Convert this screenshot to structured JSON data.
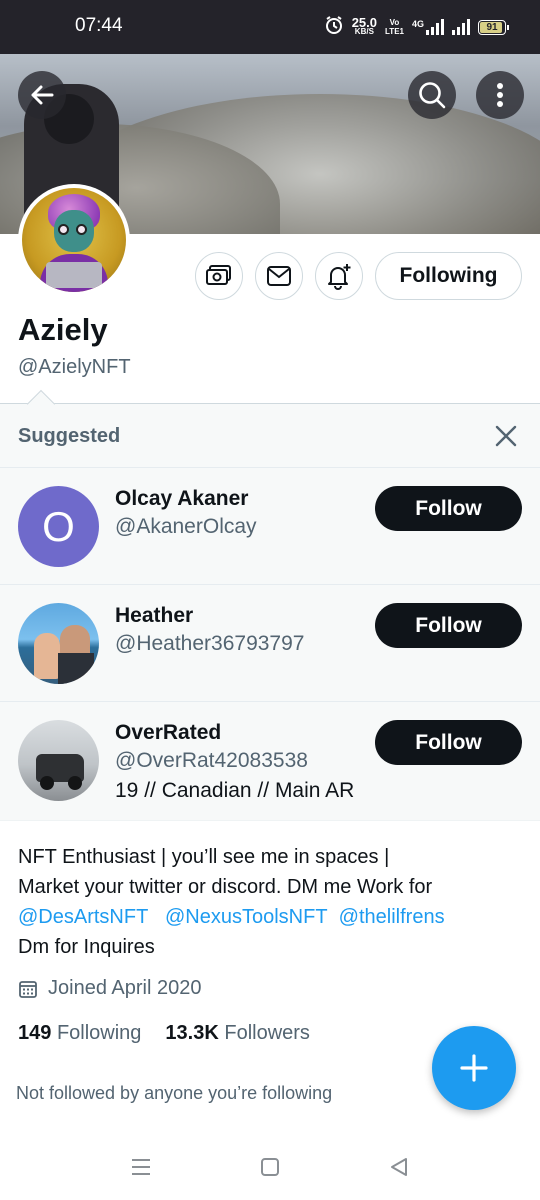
{
  "status_bar": {
    "time": "07:44",
    "net_speed_value": "25.0",
    "net_speed_unit": "KB/S",
    "volte_top": "Vo",
    "volte_bottom": "LTE1",
    "network_type": "4G",
    "battery": "91"
  },
  "header": {
    "back_icon": "arrow-left-icon",
    "search_icon": "search-icon",
    "more_icon": "more-vertical-icon"
  },
  "profile": {
    "display_name": "Aziely",
    "handle": "@AzielyNFT",
    "following_button_label": "Following",
    "action_icons": [
      "tip-jar-icon",
      "message-icon",
      "notification-bell-icon"
    ]
  },
  "suggested": {
    "title": "Suggested",
    "close_icon": "close-icon",
    "items": [
      {
        "name": "Olcay Akaner",
        "handle": "@AkanerOlcay",
        "avatar_letter": "O",
        "avatar_color": "#6f6acb",
        "bio": "",
        "follow_label": "Follow"
      },
      {
        "name": "Heather",
        "handle": "@Heather36793797",
        "bio": "",
        "follow_label": "Follow"
      },
      {
        "name": "OverRated",
        "handle": "@OverRat42083538",
        "bio": "19 // Canadian // Main AR",
        "follow_label": "Follow"
      }
    ]
  },
  "bio": {
    "line1": "NFT Enthusiast | you’ll see me in spaces |",
    "line2": "Market your twitter or discord. DM me  Work for",
    "mentions": [
      "@DesArtsNFT",
      "@NexusToolsNFT",
      "@thelilfrens"
    ],
    "line4": "Dm for Inquires"
  },
  "joined": "Joined April 2020",
  "stats": {
    "following_count": "149",
    "following_label": "Following",
    "followers_count": "13.3K",
    "followers_label": "Followers"
  },
  "not_followed_text": "Not followed by anyone you’re following",
  "fab_icon": "plus-icon",
  "colors": {
    "accent": "#1d9bf0",
    "text_primary": "#0f1419",
    "text_secondary": "#536471",
    "follow_button": "#0f1419"
  },
  "nav": {
    "menu_icon": "menu-icon",
    "home_icon": "square-icon",
    "back_icon": "triangle-back-icon"
  }
}
